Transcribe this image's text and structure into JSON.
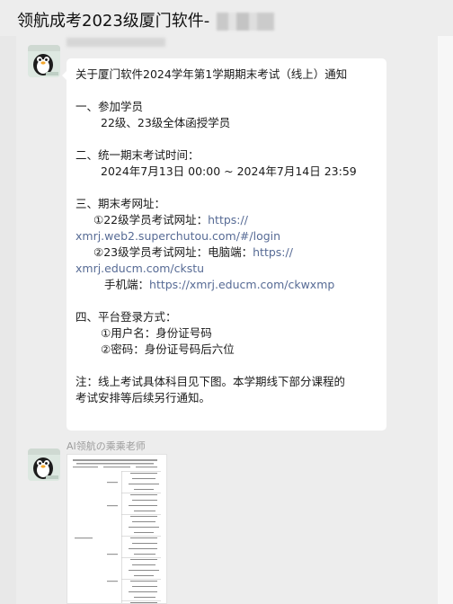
{
  "header": {
    "title": "领航成考2023级厦门软件-"
  },
  "messages": [
    {
      "lines": [
        "关于厦门软件2024学年第1学期期末考试（线上）通知",
        "一、参加学员",
        "22级、23级全体函授学员",
        "二、统一期末考试时间：",
        "2024年7月13日 00:00 ~ 2024年7月14日 23:59",
        "三、期末考网址：",
        "①22级学员考试网址：",
        "https://",
        "xmrj.web2.superchutou.com/#/login",
        "②23级学员考试网址：电脑端：",
        "https://",
        "xmrj.educm.com/ckstu",
        "手机端：",
        "https://xmrj.educm.com/ckwxmp",
        "四、平台登录方式：",
        "①用户名：身份证号码",
        "②密码：身份证号码后六位",
        "注：线上考试具体科目见下图。本学期线下部分课程的",
        "考试安排等后续另行通知。"
      ]
    },
    {
      "sender": "AI领航の乘乘老师"
    }
  ]
}
